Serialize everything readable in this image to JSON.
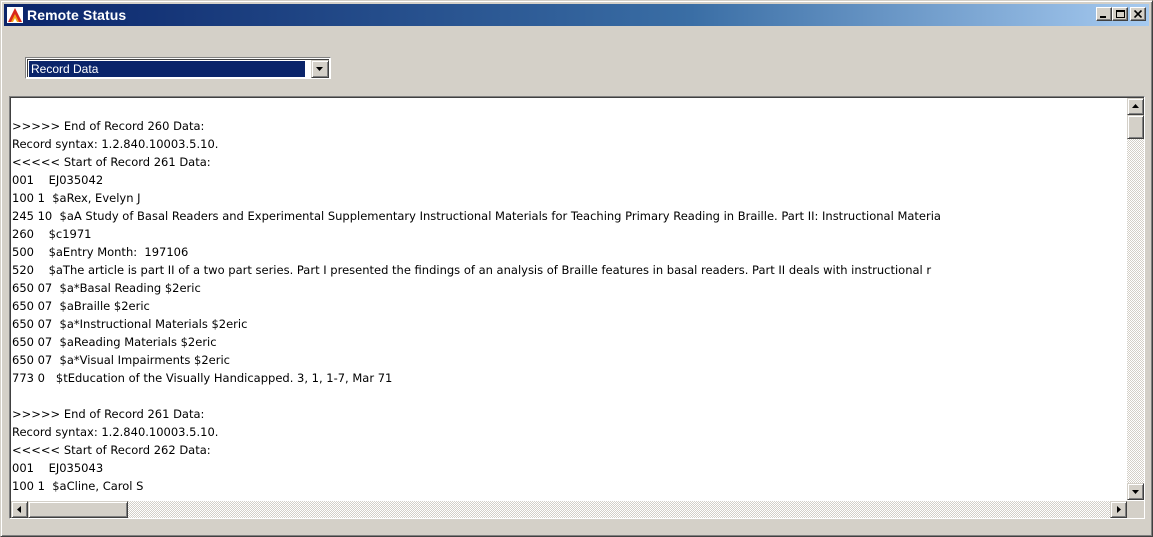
{
  "window": {
    "title": "Remote Status",
    "icon": "app-logo-icon",
    "controls": {
      "minimize_icon": "minimize-icon",
      "maximize_icon": "maximize-icon",
      "close_icon": "close-icon"
    }
  },
  "view_select": {
    "selected": "Record Data"
  },
  "output": {
    "lines": [
      ">>>>> End of Record 260 Data:",
      "Record syntax: 1.2.840.10003.5.10.",
      "<<<<< Start of Record 261 Data:",
      "001    EJ035042",
      "100 1  $aRex, Evelyn J",
      "245 10  $aA Study of Basal Readers and Experimental Supplementary Instructional Materials for Teaching Primary Reading in Braille. Part II: Instructional Materia",
      "260    $c1971",
      "500    $aEntry Month:  197106",
      "520    $aThe article is part II of a two part series. Part I presented the findings of an analysis of Braille features in basal readers. Part II deals with instructional r",
      "650 07  $a*Basal Reading $2eric",
      "650 07  $aBraille $2eric",
      "650 07  $a*Instructional Materials $2eric",
      "650 07  $aReading Materials $2eric",
      "650 07  $a*Visual Impairments $2eric",
      "773 0   $tEducation of the Visually Handicapped. 3, 1, 1-7, Mar 71",
      "",
      ">>>>> End of Record 261 Data:",
      "Record syntax: 1.2.840.10003.5.10.",
      "<<<<< Start of Record 262 Data:",
      "001    EJ035043",
      "100 1  $aCline, Carol S"
    ]
  },
  "scrollbars": {
    "vertical": {
      "up_icon": "scroll-up-icon",
      "down_icon": "scroll-down-icon"
    },
    "horizontal": {
      "left_icon": "scroll-left-icon",
      "right_icon": "scroll-right-icon"
    }
  }
}
